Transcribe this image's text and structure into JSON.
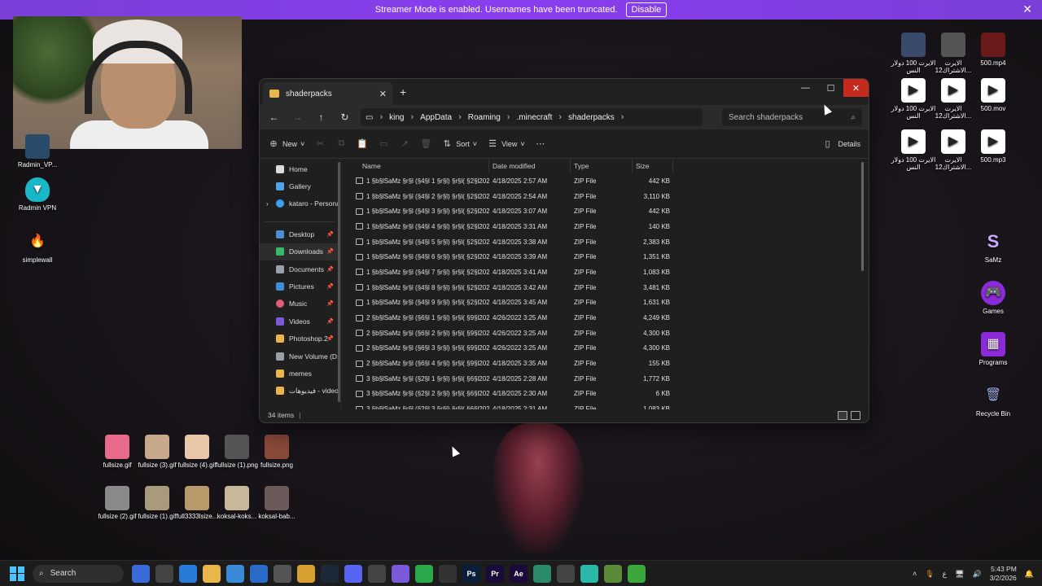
{
  "banner": {
    "text": "Streamer Mode is enabled. Usernames have been truncated.",
    "button": "Disable"
  },
  "desktop_left": [
    {
      "label": "Radmin_VP...",
      "icon": "radmin-vpn-installer-icon"
    },
    {
      "label": "Radmin VPN",
      "icon": "radmin-vpn-icon"
    },
    {
      "label": "simplewall",
      "icon": "simplewall-icon"
    }
  ],
  "desktop_right": [
    {
      "label": "الايرت 100 دولار النس",
      "icon": "image-file-icon"
    },
    {
      "label": "الايرت الاشتراك12...",
      "icon": "image-file-icon"
    },
    {
      "label": "500.mp4",
      "icon": "video-file-icon"
    },
    {
      "label": "الايرت 100 دولار النس",
      "icon": "video-file-icon"
    },
    {
      "label": "الايرت الاشتراك12...",
      "icon": "video-file-icon"
    },
    {
      "label": "500.mov",
      "icon": "video-file-icon"
    },
    {
      "label": "الايرت 100 دولار النس",
      "icon": "audio-file-icon"
    },
    {
      "label": "الايرت الاشتراك12...",
      "icon": "audio-file-icon"
    },
    {
      "label": "500.mp3",
      "icon": "audio-file-icon"
    },
    {
      "label": "SaMz",
      "icon": "samz-icon"
    },
    {
      "label": "Games",
      "icon": "games-icon"
    },
    {
      "label": "Programs",
      "icon": "programs-icon"
    },
    {
      "label": "Recycle Bin",
      "icon": "recycle-bin-icon"
    }
  ],
  "desktop_bottom": [
    {
      "label": "fullsize.gif"
    },
    {
      "label": "fullsize (3).gif"
    },
    {
      "label": "fullsize (4).gif"
    },
    {
      "label": "fullsize (1).png"
    },
    {
      "label": "fullsize.png"
    },
    {
      "label": "fullsize (2).gif"
    },
    {
      "label": "fullsize (1).gif"
    },
    {
      "label": "full3333lsize..."
    },
    {
      "label": "koksal-koks..."
    },
    {
      "label": "koksal-bab..."
    }
  ],
  "explorer": {
    "tab_title": "shaderpacks",
    "breadcrumb": [
      "king",
      "AppData",
      "Roaming",
      ".minecraft",
      "shaderpacks"
    ],
    "search_placeholder": "Search shaderpacks",
    "toolbar": {
      "new": "New",
      "sort": "Sort",
      "view": "View",
      "details": "Details"
    },
    "nav": [
      {
        "label": "Home",
        "color": "#e0e0e0"
      },
      {
        "label": "Gallery",
        "color": "#4ea3e8"
      },
      {
        "label": "kataro - Persona",
        "color": "#3aa0f0"
      },
      {
        "label": "Desktop",
        "color": "#4a8fd8"
      },
      {
        "label": "Downloads",
        "color": "#3ab86a"
      },
      {
        "label": "Documents",
        "color": "#9aa0a8"
      },
      {
        "label": "Pictures",
        "color": "#3a8fd8"
      },
      {
        "label": "Music",
        "color": "#e05a7a"
      },
      {
        "label": "Videos",
        "color": "#7a5ad8"
      },
      {
        "label": "Photoshop.2",
        "color": "#e8b64a"
      },
      {
        "label": "New Volume (D:",
        "color": "#9aa0a8"
      },
      {
        "label": "memes",
        "color": "#e8b64a"
      },
      {
        "label": "فيديوهات - video",
        "color": "#e8b64a"
      }
    ],
    "columns": {
      "name": "Name",
      "date": "Date modified",
      "type": "Type",
      "size": "Size"
    },
    "rows": [
      {
        "name": "1 §b§lSaMz §r§l (§4§l 1 §r§l) §r§l( §2§l2025§r...",
        "date": "4/18/2025 2:57 AM",
        "type": "ZIP File",
        "size": "442 KB"
      },
      {
        "name": "1 §b§lSaMz §r§l (§4§l 2 §r§l) §r§l( §2§l2025§r...",
        "date": "4/18/2025 2:54 AM",
        "type": "ZIP File",
        "size": "3,110 KB"
      },
      {
        "name": "1 §b§lSaMz §r§l (§4§l 3 §r§l) §r§l( §2§l2025§r...",
        "date": "4/18/2025 3:07 AM",
        "type": "ZIP File",
        "size": "442 KB"
      },
      {
        "name": "1 §b§lSaMz §r§l (§4§l 4 §r§l) §r§l( §2§l2025§r...",
        "date": "4/18/2025 3:31 AM",
        "type": "ZIP File",
        "size": "140 KB"
      },
      {
        "name": "1 §b§lSaMz §r§l (§4§l 5 §r§l) §r§l( §2§l2025§r...",
        "date": "4/18/2025 3:38 AM",
        "type": "ZIP File",
        "size": "2,383 KB"
      },
      {
        "name": "1 §b§lSaMz §r§l (§4§l 6 §r§l) §r§l( §2§l2025§r...",
        "date": "4/18/2025 3:39 AM",
        "type": "ZIP File",
        "size": "1,351 KB"
      },
      {
        "name": "1 §b§lSaMz §r§l (§4§l 7 §r§l) §r§l( §2§l2025§r...",
        "date": "4/18/2025 3:41 AM",
        "type": "ZIP File",
        "size": "1,083 KB"
      },
      {
        "name": "1 §b§lSaMz §r§l (§4§l 8 §r§l) §r§l( §2§l2025§r...",
        "date": "4/18/2025 3:42 AM",
        "type": "ZIP File",
        "size": "3,481 KB"
      },
      {
        "name": "1 §b§lSaMz §r§l (§4§l 9 §r§l) §r§l( §2§l2025§r...",
        "date": "4/18/2025 3:45 AM",
        "type": "ZIP File",
        "size": "1,631 KB"
      },
      {
        "name": "2 §b§lSaMz §r§l (§6§l 1 §r§l) §r§l( §9§l2024§r...",
        "date": "4/26/2022 3:25 AM",
        "type": "ZIP File",
        "size": "4,249 KB"
      },
      {
        "name": "2 §b§lSaMz §r§l (§6§l 2 §r§l) §r§l( §9§l2024§r...",
        "date": "4/26/2022 3:25 AM",
        "type": "ZIP File",
        "size": "4,300 KB"
      },
      {
        "name": "2 §b§lSaMz §r§l (§6§l 3 §r§l) §r§l( §9§l2024§r...",
        "date": "4/26/2022 3:25 AM",
        "type": "ZIP File",
        "size": "4,300 KB"
      },
      {
        "name": "2 §b§lSaMz §r§l (§6§l 4 §r§l) §r§l( §9§l2024§r...",
        "date": "4/18/2025 3:35 AM",
        "type": "ZIP File",
        "size": "155 KB"
      },
      {
        "name": "3 §b§lSaMz §r§l (§2§l 1 §r§l) §r§l( §6§l2023§r...",
        "date": "4/18/2025 2:28 AM",
        "type": "ZIP File",
        "size": "1,772 KB"
      },
      {
        "name": "3 §b§lSaMz §r§l (§2§l 2 §r§l) §r§l( §6§l2023§r...",
        "date": "4/18/2025 2:30 AM",
        "type": "ZIP File",
        "size": "6 KB"
      },
      {
        "name": "3 §b§lSaMz §r§l (§2§l 3 §r§l) §r§l( §6§l2023§r...",
        "date": "4/18/2025 2:31 AM",
        "type": "ZIP File",
        "size": "1,083 KB"
      }
    ],
    "status": "34 items"
  },
  "taskbar": {
    "search": "Search",
    "apps": [
      {
        "name": "copilot-icon",
        "label": "",
        "color": "#3a6ad8"
      },
      {
        "name": "task-view-icon",
        "label": "",
        "color": "#444"
      },
      {
        "name": "multi-app-icon",
        "label": "",
        "color": "#2a7ad8"
      },
      {
        "name": "file-explorer-icon",
        "label": "",
        "color": "#e8b64a"
      },
      {
        "name": "store-icon",
        "label": "",
        "color": "#3a8ad8"
      },
      {
        "name": "outlook-icon",
        "label": "",
        "color": "#2a6ac8"
      },
      {
        "name": "settings-icon",
        "label": "",
        "color": "#555"
      },
      {
        "name": "chrome-icon",
        "label": "",
        "color": "#d8a030"
      },
      {
        "name": "steam-icon",
        "label": "",
        "color": "#1b2838"
      },
      {
        "name": "discord-icon",
        "label": "",
        "color": "#5865f2"
      },
      {
        "name": "xbox-icon",
        "label": "",
        "color": "#444"
      },
      {
        "name": "gamepad-icon",
        "label": "",
        "color": "#7a5ad8"
      },
      {
        "name": "chat-icon",
        "label": "",
        "color": "#2aa84a"
      },
      {
        "name": "obs-icon",
        "label": "",
        "color": "#333"
      },
      {
        "name": "photoshop-icon",
        "label": "Ps",
        "color": "#0a1e3a"
      },
      {
        "name": "premiere-icon",
        "label": "Pr",
        "color": "#1a0a3a"
      },
      {
        "name": "after-effects-icon",
        "label": "Ae",
        "color": "#1a0a3a"
      },
      {
        "name": "tool-icon",
        "label": "",
        "color": "#2a8a6a"
      },
      {
        "name": "browser-icon",
        "label": "",
        "color": "#444"
      },
      {
        "name": "radmin-icon",
        "label": "",
        "color": "#2ab8a8"
      },
      {
        "name": "minecraft-icon",
        "label": "",
        "color": "#5a8a3a"
      },
      {
        "name": "creeper-icon",
        "label": "",
        "color": "#3aa83a"
      }
    ],
    "lang": "ع",
    "time": "5:43 PM",
    "date": "3/2/2026"
  }
}
